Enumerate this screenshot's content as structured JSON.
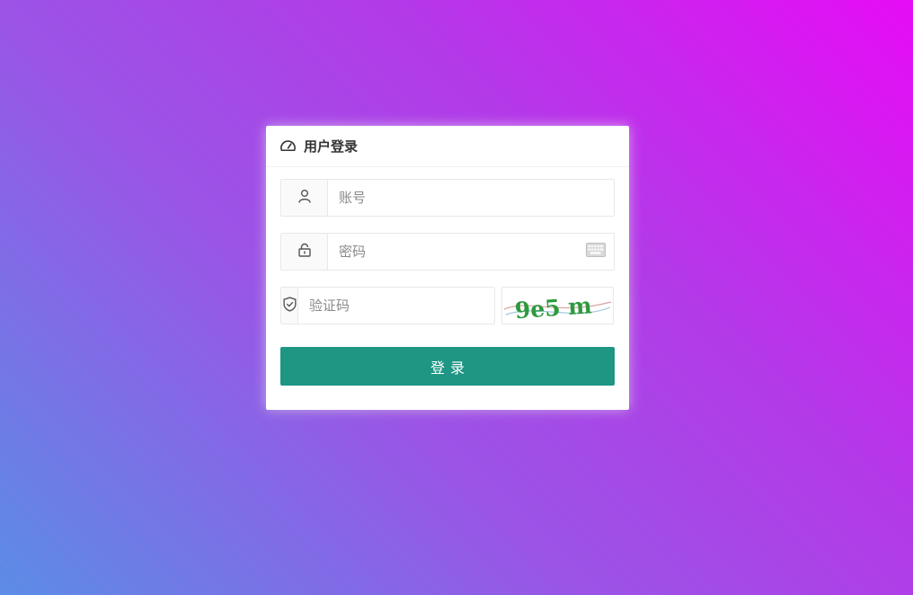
{
  "login": {
    "title": "用户登录",
    "title_icon": "dashboard-icon",
    "username": {
      "placeholder": "账号",
      "value": "",
      "icon": "user-icon"
    },
    "password": {
      "placeholder": "密码",
      "value": "",
      "icon": "lock-icon",
      "keyboard_icon": "keyboard-icon"
    },
    "captcha": {
      "placeholder": "验证码",
      "value": "",
      "icon": "shield-icon",
      "image_text": "9e5 m"
    },
    "submit_label": "登录"
  },
  "colors": {
    "gradient": [
      "#e60cf5",
      "#b33ae8",
      "#9a55e6",
      "#5b8de6"
    ],
    "button": "#1e9683",
    "captcha_text": "#2e9a3e"
  }
}
